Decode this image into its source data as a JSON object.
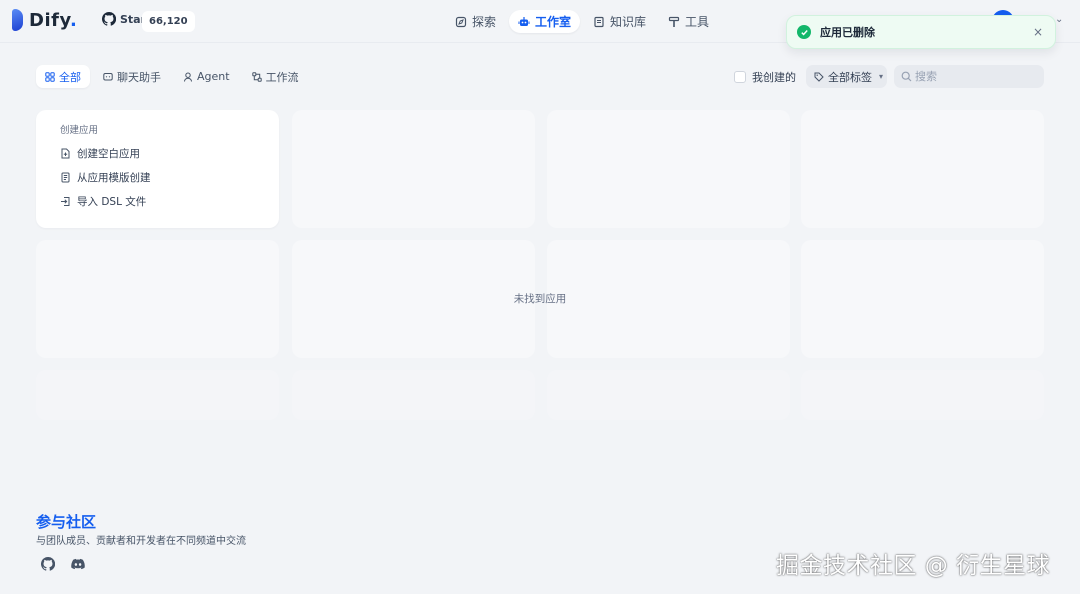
{
  "app": {
    "logo_text": "Dify",
    "logo_dot": ".",
    "star_label": "Star",
    "star_count": "66,120"
  },
  "nav": {
    "items": [
      {
        "label": "探索",
        "icon": "compass-icon"
      },
      {
        "label": "工作室",
        "icon": "robot-icon",
        "active": true
      },
      {
        "label": "知识库",
        "icon": "book-icon"
      },
      {
        "label": "工具",
        "icon": "hammer-icon"
      }
    ]
  },
  "toast": {
    "message": "应用已删除",
    "close": "×",
    "color": "#12b76a"
  },
  "filters": {
    "tabs": [
      {
        "label": "全部",
        "icon": "grid-icon",
        "active": true
      },
      {
        "label": "聊天助手",
        "icon": "chat-icon"
      },
      {
        "label": "Agent",
        "icon": "agent-icon"
      },
      {
        "label": "工作流",
        "icon": "workflow-icon"
      }
    ],
    "mine_label": "我创建的",
    "tag_label": "全部标签",
    "search_placeholder": "搜索"
  },
  "create": {
    "title": "创建应用",
    "items": [
      {
        "label": "创建空白应用",
        "icon": "file-plus-icon"
      },
      {
        "label": "从应用模版创建",
        "icon": "template-icon"
      },
      {
        "label": "导入 DSL 文件",
        "icon": "import-icon"
      }
    ]
  },
  "empty_message": "未找到应用",
  "community": {
    "title": "参与社区",
    "subtitle": "与团队成员、贡献者和开发者在不同频道中交流"
  },
  "watermark": "掘金技术社区 @ 衍生星球",
  "colors": {
    "accent": "#155eef",
    "background": "#f2f4f7"
  }
}
